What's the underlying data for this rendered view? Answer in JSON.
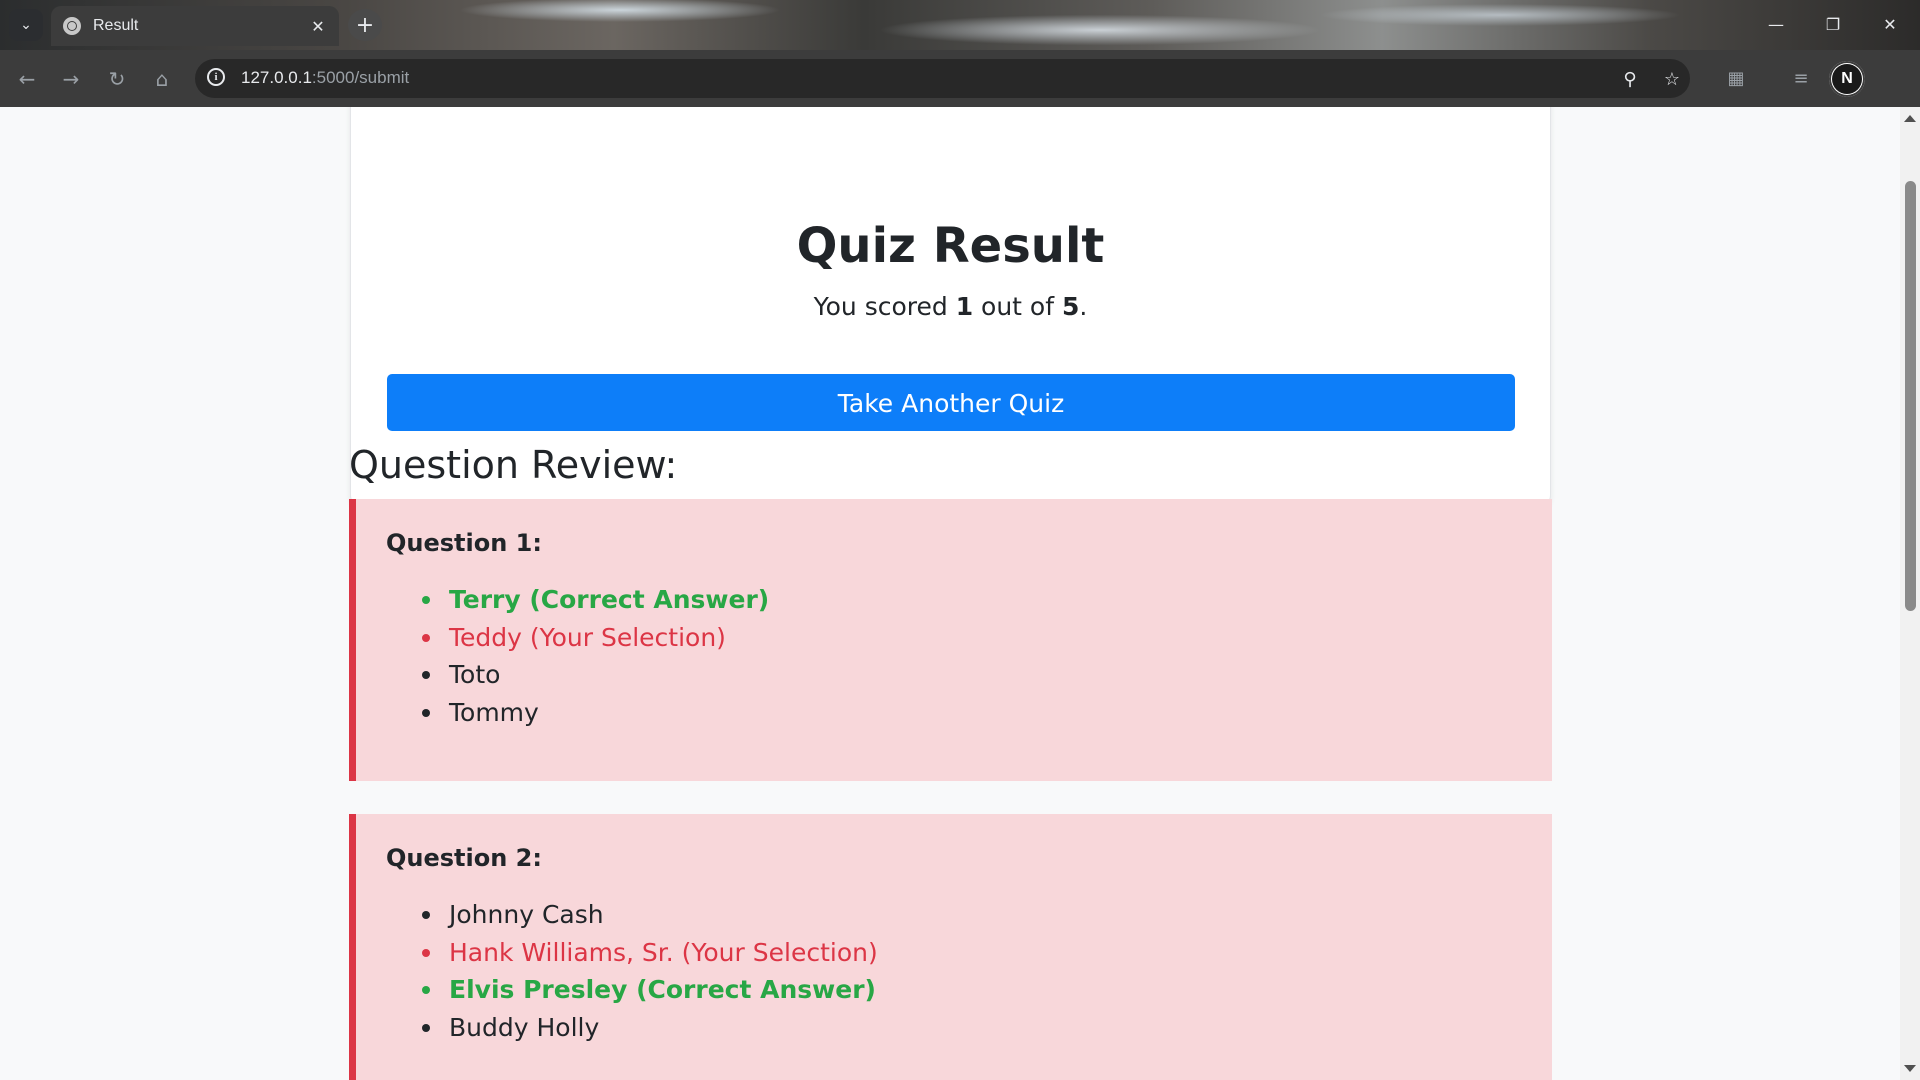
{
  "browser": {
    "tab_title": "Result",
    "url_host": "127.0.0.1",
    "url_path": ":5000/submit",
    "profile_initial": "N",
    "icons": {
      "tab_search": "chevron-down-icon",
      "tab_close": "close-icon",
      "new_tab": "plus-icon",
      "back": "arrow-left-icon",
      "forward": "arrow-right-icon",
      "reload": "reload-icon",
      "home": "home-icon",
      "site_info": "info-icon",
      "zoom": "zoom-icon",
      "bookmark": "star-icon",
      "extensions": "puzzle-icon",
      "media": "media-queue-icon"
    }
  },
  "result": {
    "title": "Quiz Result",
    "score_prefix": "You scored ",
    "score": "1",
    "score_middle": " out of ",
    "total": "5",
    "score_suffix": ".",
    "button_label": "Take Another Quiz"
  },
  "review": {
    "heading": "Question Review:",
    "questions": [
      {
        "title": "Question 1:",
        "options": [
          {
            "text": "Terry (Correct Answer)",
            "state": "correct"
          },
          {
            "text": "Teddy (Your Selection)",
            "state": "selected"
          },
          {
            "text": "Toto",
            "state": "normal"
          },
          {
            "text": "Tommy",
            "state": "normal"
          }
        ]
      },
      {
        "title": "Question 2:",
        "options": [
          {
            "text": "Johnny Cash",
            "state": "normal"
          },
          {
            "text": "Hank Williams, Sr. (Your Selection)",
            "state": "selected"
          },
          {
            "text": "Elvis Presley (Correct Answer)",
            "state": "correct"
          },
          {
            "text": "Buddy Holly",
            "state": "normal"
          }
        ]
      }
    ]
  },
  "colors": {
    "primary_button": "#0d7ef9",
    "incorrect_card_bg": "#f8d7da",
    "incorrect_card_border": "#dc3545",
    "correct_text": "#28a745",
    "selected_text": "#dc3545"
  }
}
